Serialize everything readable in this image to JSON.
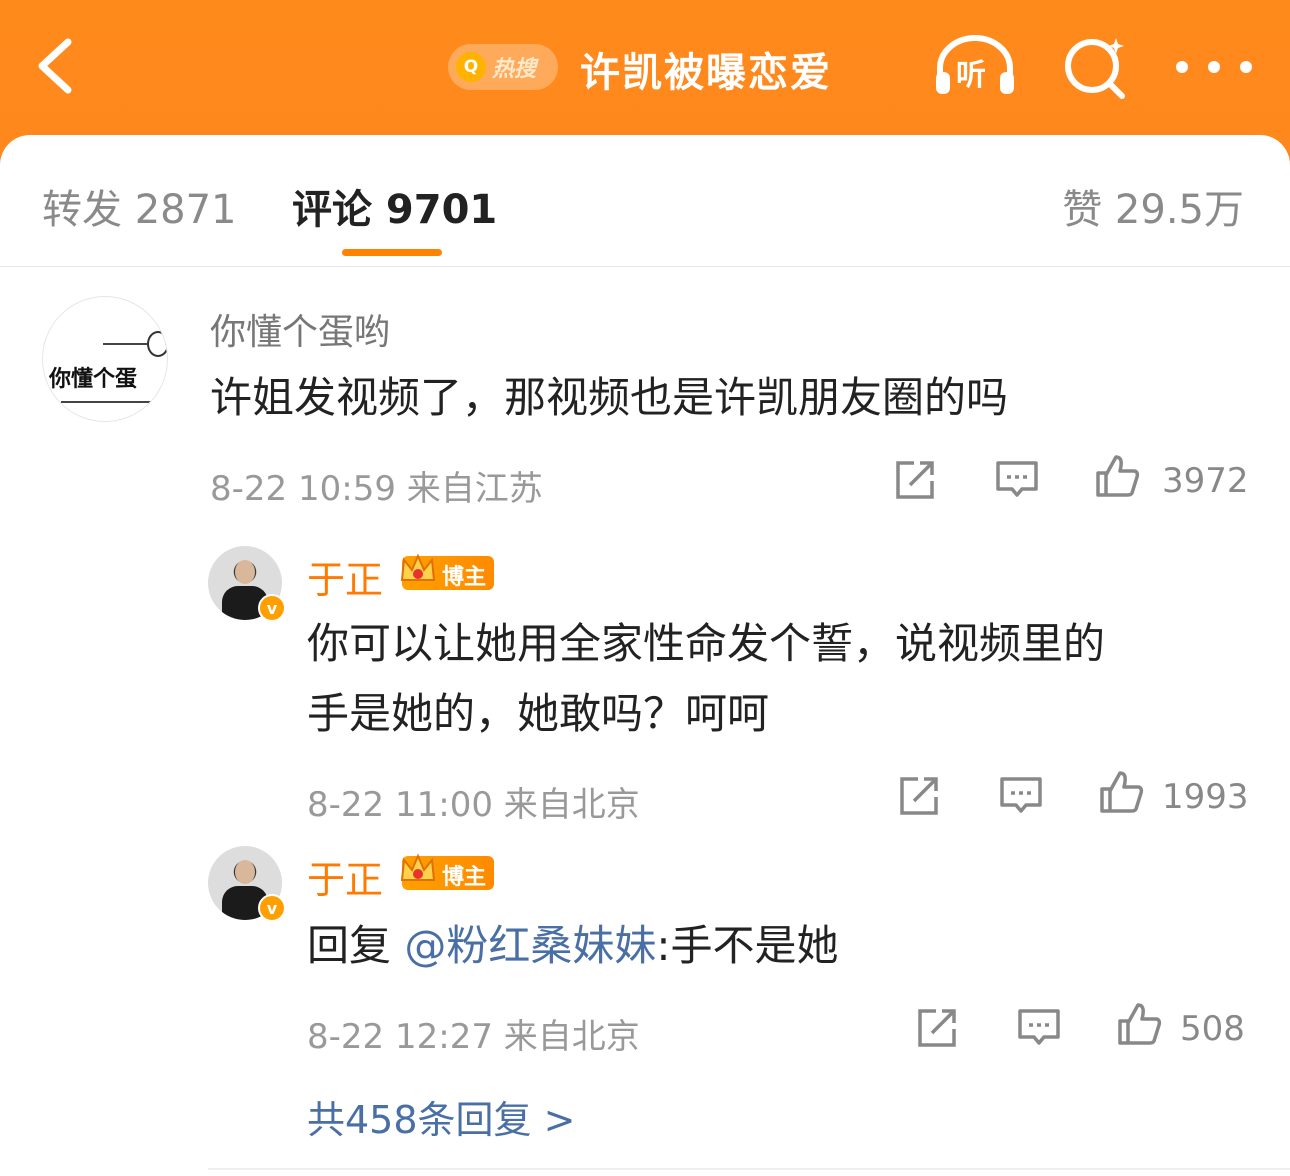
{
  "header": {
    "hot_q": "Q",
    "hot_label": "热搜",
    "topic": "许凯被曝恋爱",
    "listen_label": "听"
  },
  "tabs": {
    "repost": "转发 2871",
    "comments": "评论 9701",
    "likes": "赞 29.5万"
  },
  "comment": {
    "author": "你懂个蛋哟",
    "avatar_text": "你懂个蛋",
    "text": "许姐发视频了，那视频也是许凯朋友圈的吗",
    "meta": "8-22 10:59  来自江苏",
    "likes": "3972"
  },
  "replies": [
    {
      "author": "于正",
      "badge": "博主",
      "verified": "v",
      "lines": [
        "你可以让她用全家性命发个誓，说视频里的",
        "手是她的，她敢吗？呵呵"
      ],
      "meta": "8-22 11:00  来自北京",
      "likes": "1993"
    },
    {
      "author": "于正",
      "badge": "博主",
      "verified": "v",
      "prefix": "回复 ",
      "mention": "@粉红桑妹妹",
      "rest": ":手不是她",
      "meta": "8-22 12:27  来自北京",
      "likes": "508"
    }
  ],
  "more_replies": "共458条回复 >",
  "colors": {
    "accent": "#ff8200",
    "link": "#4a6fa5",
    "header": "#ff7a18"
  },
  "icons": [
    "back-icon",
    "search-icon",
    "headphones-icon",
    "more-icon",
    "share-icon",
    "comment-icon",
    "like-icon",
    "crown-icon",
    "verified-icon"
  ]
}
